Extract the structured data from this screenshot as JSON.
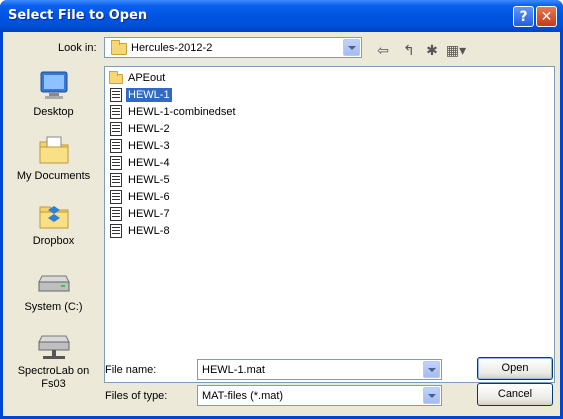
{
  "window": {
    "title": "Select File to Open"
  },
  "titlebar_buttons": {
    "help": "?",
    "close": "✕"
  },
  "lookin": {
    "label": "Look in:",
    "value": "Hercules-2012-2"
  },
  "toolbar": [
    {
      "name": "back-icon",
      "glyph": "⇦"
    },
    {
      "name": "up-one-level-icon",
      "glyph": "↰"
    },
    {
      "name": "new-folder-icon",
      "glyph": "✱"
    },
    {
      "name": "view-menu-icon",
      "glyph": "▦▾"
    }
  ],
  "places": [
    {
      "label": "Desktop",
      "icon": "desktop-icon"
    },
    {
      "label": "My Documents",
      "icon": "my-documents-icon"
    },
    {
      "label": "Dropbox",
      "icon": "dropbox-icon"
    },
    {
      "label": "System (C:)",
      "icon": "drive-icon"
    },
    {
      "label": "SpectroLab on Fs03",
      "icon": "network-drive-icon"
    }
  ],
  "files": [
    {
      "name": "APEout",
      "type": "folder",
      "selected": false
    },
    {
      "name": "HEWL-1",
      "type": "mat",
      "selected": true
    },
    {
      "name": "HEWL-1-combinedset",
      "type": "mat",
      "selected": false
    },
    {
      "name": "HEWL-2",
      "type": "mat",
      "selected": false
    },
    {
      "name": "HEWL-3",
      "type": "mat",
      "selected": false
    },
    {
      "name": "HEWL-4",
      "type": "mat",
      "selected": false
    },
    {
      "name": "HEWL-5",
      "type": "mat",
      "selected": false
    },
    {
      "name": "HEWL-6",
      "type": "mat",
      "selected": false
    },
    {
      "name": "HEWL-7",
      "type": "mat",
      "selected": false
    },
    {
      "name": "HEWL-8",
      "type": "mat",
      "selected": false
    }
  ],
  "filename": {
    "label": "File name:",
    "value": "HEWL-1.mat"
  },
  "filetype": {
    "label": "Files of type:",
    "value": "MAT-files (*.mat)"
  },
  "buttons": {
    "open": "Open",
    "cancel": "Cancel"
  },
  "colors": {
    "selection": "#316ac5",
    "titlebar": "#0054e3",
    "dialog_bg": "#ece9d8"
  }
}
